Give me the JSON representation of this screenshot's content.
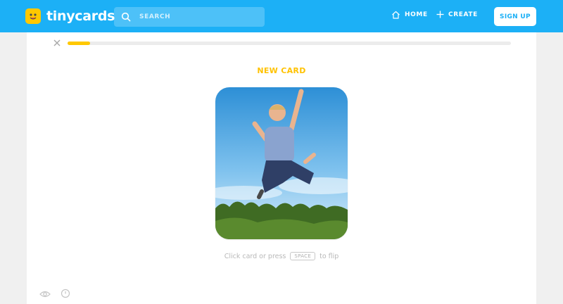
{
  "brand": {
    "name": "tinycards"
  },
  "search": {
    "placeholder": "SEARCH"
  },
  "nav": {
    "home_label": "HOME",
    "create_label": "CREATE",
    "signup_label": "SIGN UP"
  },
  "colors": {
    "nav_blue": "#1cb0f6",
    "accent_yellow": "#ffc800",
    "background_gray": "#f0f0f0"
  },
  "lesson": {
    "progress_fraction": 0.05,
    "card_title": "NEW CARD",
    "card_image": "boy-jumping-photo",
    "hint_prefix": "Click card or press",
    "hint_key": "SPACE",
    "hint_suffix": "to flip"
  },
  "icons": [
    "tinycards-logo-icon",
    "search-icon",
    "home-icon",
    "plus-icon",
    "close-icon",
    "eye-icon",
    "clock-icon"
  ]
}
